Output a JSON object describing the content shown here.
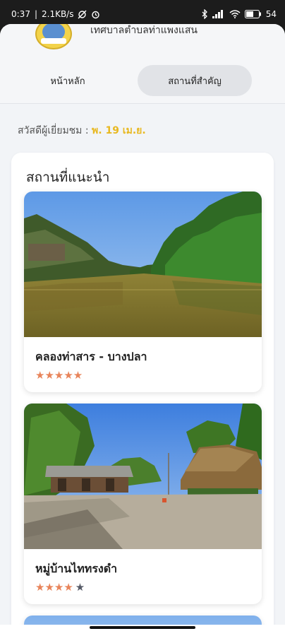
{
  "status_bar": {
    "time": "0:37",
    "network_speed": "2.1KB/s",
    "battery": "54",
    "icons": [
      "sync-off-icon",
      "alarm-icon",
      "bluetooth-icon",
      "signal-icon",
      "wifi-icon",
      "battery-icon"
    ]
  },
  "header": {
    "org_name": "เทศบาลตำบลท่าแพงแสน",
    "logo": "municipality-logo"
  },
  "tabs": [
    {
      "label": "หน้าหลัก",
      "active": false
    },
    {
      "label": "สถานที่สำคัญ",
      "active": true
    }
  ],
  "greeting": {
    "text": "สวัสดีผู้เยี่ยมชม :",
    "date": "พ. 19 เม.ย."
  },
  "section": {
    "title": "สถานที่แนะนำ"
  },
  "places": [
    {
      "name": "คลองท่าสาร - บางปลา",
      "rating": 5,
      "max_rating": 5,
      "stars": "★★★★★",
      "stars_filled": "★★★★★",
      "stars_empty": ""
    },
    {
      "name": "หมู่บ้านไททรงดำ",
      "rating": 4,
      "max_rating": 5,
      "stars": "★★★★★",
      "stars_filled": "★★★★",
      "stars_empty": "★"
    }
  ],
  "colors": {
    "accent_date": "#e8b820",
    "star_filled": "#e8845a",
    "star_empty": "#555a66",
    "active_tab": "#e1e3e7",
    "background": "#f2f4f7"
  }
}
